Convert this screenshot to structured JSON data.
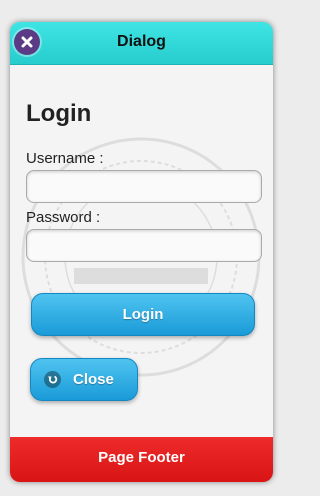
{
  "dialog": {
    "title": "Dialog",
    "close_icon": "close-x-icon"
  },
  "login_form": {
    "heading": "Login",
    "username_label": "Username :",
    "username_value": "",
    "password_label": "Password :",
    "password_value": "",
    "login_button_label": "Login",
    "close_button_label": "Close",
    "close_button_icon": "back-arrow-icon"
  },
  "footer": {
    "label": "Page Footer"
  },
  "colors": {
    "header": "#2ed6d6",
    "button": "#1fa3dd",
    "footer": "#e31c1c",
    "close_badge": "#5b3a86"
  }
}
